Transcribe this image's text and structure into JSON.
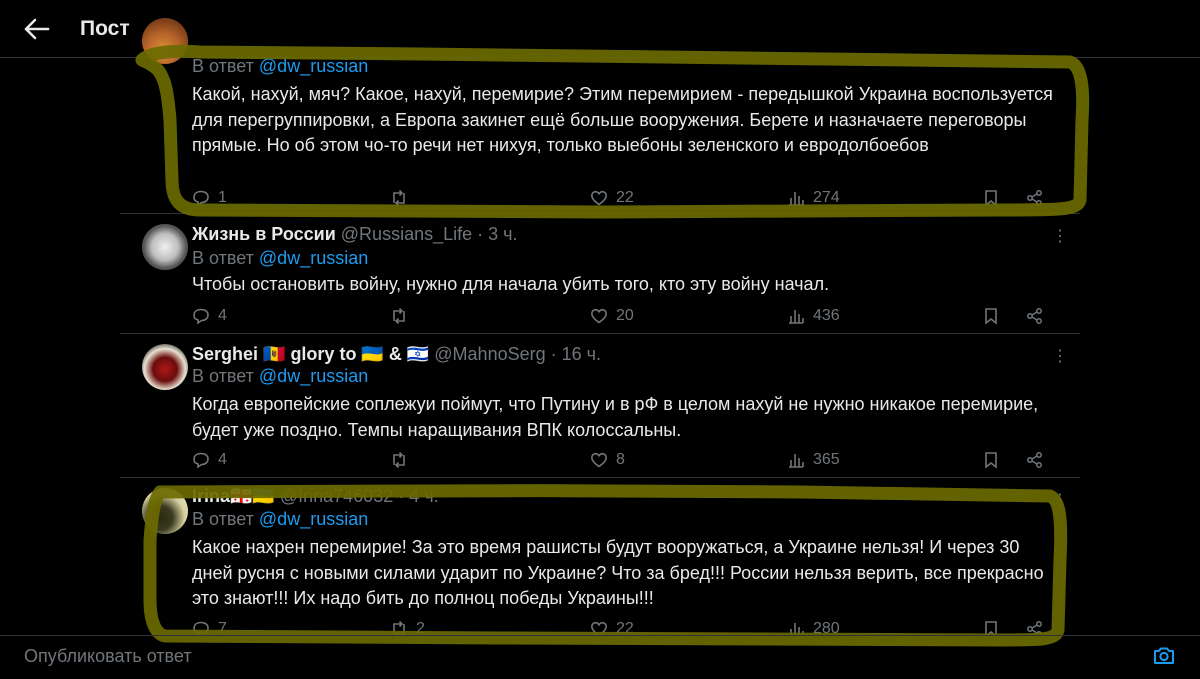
{
  "header": {
    "title": "Пост"
  },
  "tweets": [
    {
      "reply_label": "В ответ",
      "reply_to": "@dw_russian",
      "text": "Какой, нахуй, мяч? Какое, нахуй, перемирие? Этим перемирием - передышкой Украина воспользуется для перегруппировки, а Европа закинет ещё больше вооружения. Берете и назначаете переговоры прямые. Но об этом чо-то речи нет нихуя, только выебоны зеленского и евродолбоебов",
      "replies": "1",
      "reposts": "",
      "likes": "22",
      "views": "274"
    },
    {
      "name": "Жизнь в России",
      "handle": "@Russians_Life · 3 ч.",
      "reply_label": "В ответ",
      "reply_to": "@dw_russian",
      "text": "Чтобы остановить войну, нужно для начала убить того, кто эту войну начал.",
      "replies": "4",
      "reposts": "",
      "likes": "20",
      "views": "436"
    },
    {
      "name": "Serghei 🇲🇩 glory to 🇺🇦 & 🇮🇱",
      "handle": "@MahnoSerg · 16 ч.",
      "reply_label": "В ответ",
      "reply_to": "@dw_russian",
      "text": "Когда европейские соплежуи поймут, что Путину и в рФ в целом нахуй не нужно никакое перемирие, будет уже поздно. Темпы наращивания ВПК колоссальны.",
      "replies": "4",
      "reposts": "",
      "likes": "8",
      "views": "365"
    },
    {
      "name": "Irina🇬🇪🇺🇦",
      "handle": "@Irina746032 · 4 ч.",
      "reply_label": "В ответ",
      "reply_to": "@dw_russian",
      "text": "Какое нахрен перемирие! За это время рашисты будут вооружаться, а Украине нельзя! И через 30 дней русня с новыми силами ударит по Украине? Что за бред!!! России нельзя верить, все прекрасно это знают!!! Их надо бить до полноц победы Украины!!!",
      "replies": "7",
      "reposts": "2",
      "likes": "22",
      "views": "280"
    }
  ],
  "composer": {
    "placeholder": "Опубликовать ответ"
  },
  "colors": {
    "background": "#000000",
    "text": "#e7e9ea",
    "muted": "#71767b",
    "link": "#1d9bf0",
    "divider": "#2f3336",
    "highlight_marker": "#6b6a00"
  },
  "icons": [
    "back-arrow-icon",
    "reply-icon",
    "repost-icon",
    "like-icon",
    "views-icon",
    "bookmark-icon",
    "share-icon",
    "more-icon",
    "camera-icon"
  ]
}
